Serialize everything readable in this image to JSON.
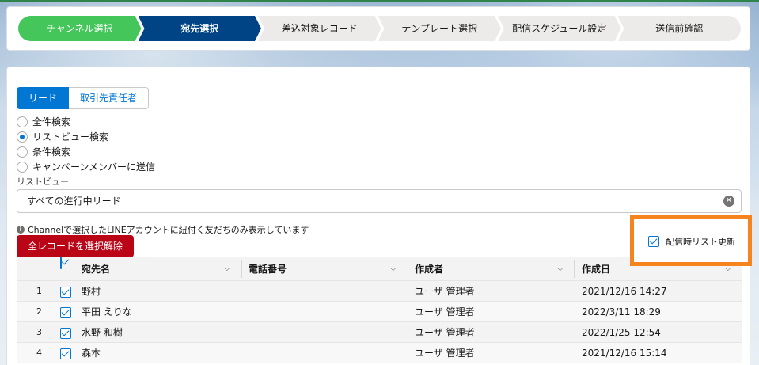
{
  "path": {
    "steps": [
      {
        "label": "チャンネル選択",
        "state": "done"
      },
      {
        "label": "宛先選択",
        "state": "current"
      },
      {
        "label": "差込対象レコード",
        "state": "todo"
      },
      {
        "label": "テンプレート選択",
        "state": "todo"
      },
      {
        "label": "配信スケジュール設定",
        "state": "todo"
      },
      {
        "label": "送信前確認",
        "state": "todo"
      }
    ]
  },
  "tabs": [
    {
      "label": "リード",
      "active": true
    },
    {
      "label": "取引先責任者",
      "active": false
    }
  ],
  "search_options": [
    {
      "label": "全件検索",
      "checked": false
    },
    {
      "label": "リストビュー検索",
      "checked": true
    },
    {
      "label": "条件検索",
      "checked": false
    },
    {
      "label": "キャンペーンメンバーに送信",
      "checked": false
    }
  ],
  "listview": {
    "label": "リストビュー",
    "value": "すべての進行中リード"
  },
  "info_text": "Channelで選択したLINEアカウントに紐付く友だちのみ表示しています",
  "deselect_button": "全レコードを選択解除",
  "refresh_checkbox": {
    "label": "配信時リスト更新",
    "checked": true
  },
  "table": {
    "columns": [
      "宛先名",
      "電話番号",
      "作成者",
      "作成日"
    ],
    "rows": [
      {
        "num": "1",
        "name": "野村",
        "phone": "",
        "creator": "ユーザ 管理者",
        "created": "2021/12/16 14:27"
      },
      {
        "num": "2",
        "name": "平田 えりな",
        "phone": "",
        "creator": "ユーザ 管理者",
        "created": "2022/3/11 18:29"
      },
      {
        "num": "3",
        "name": "水野 和樹",
        "phone": "",
        "creator": "ユーザ 管理者",
        "created": "2022/1/25 12:54"
      },
      {
        "num": "4",
        "name": "森本",
        "phone": "",
        "creator": "ユーザ 管理者",
        "created": "2021/12/16 15:14"
      }
    ]
  },
  "colors": {
    "done": "#45c65a",
    "current": "#014486",
    "brand": "#0176d3",
    "destructive": "#ba0517",
    "highlight": "#f5841f"
  }
}
